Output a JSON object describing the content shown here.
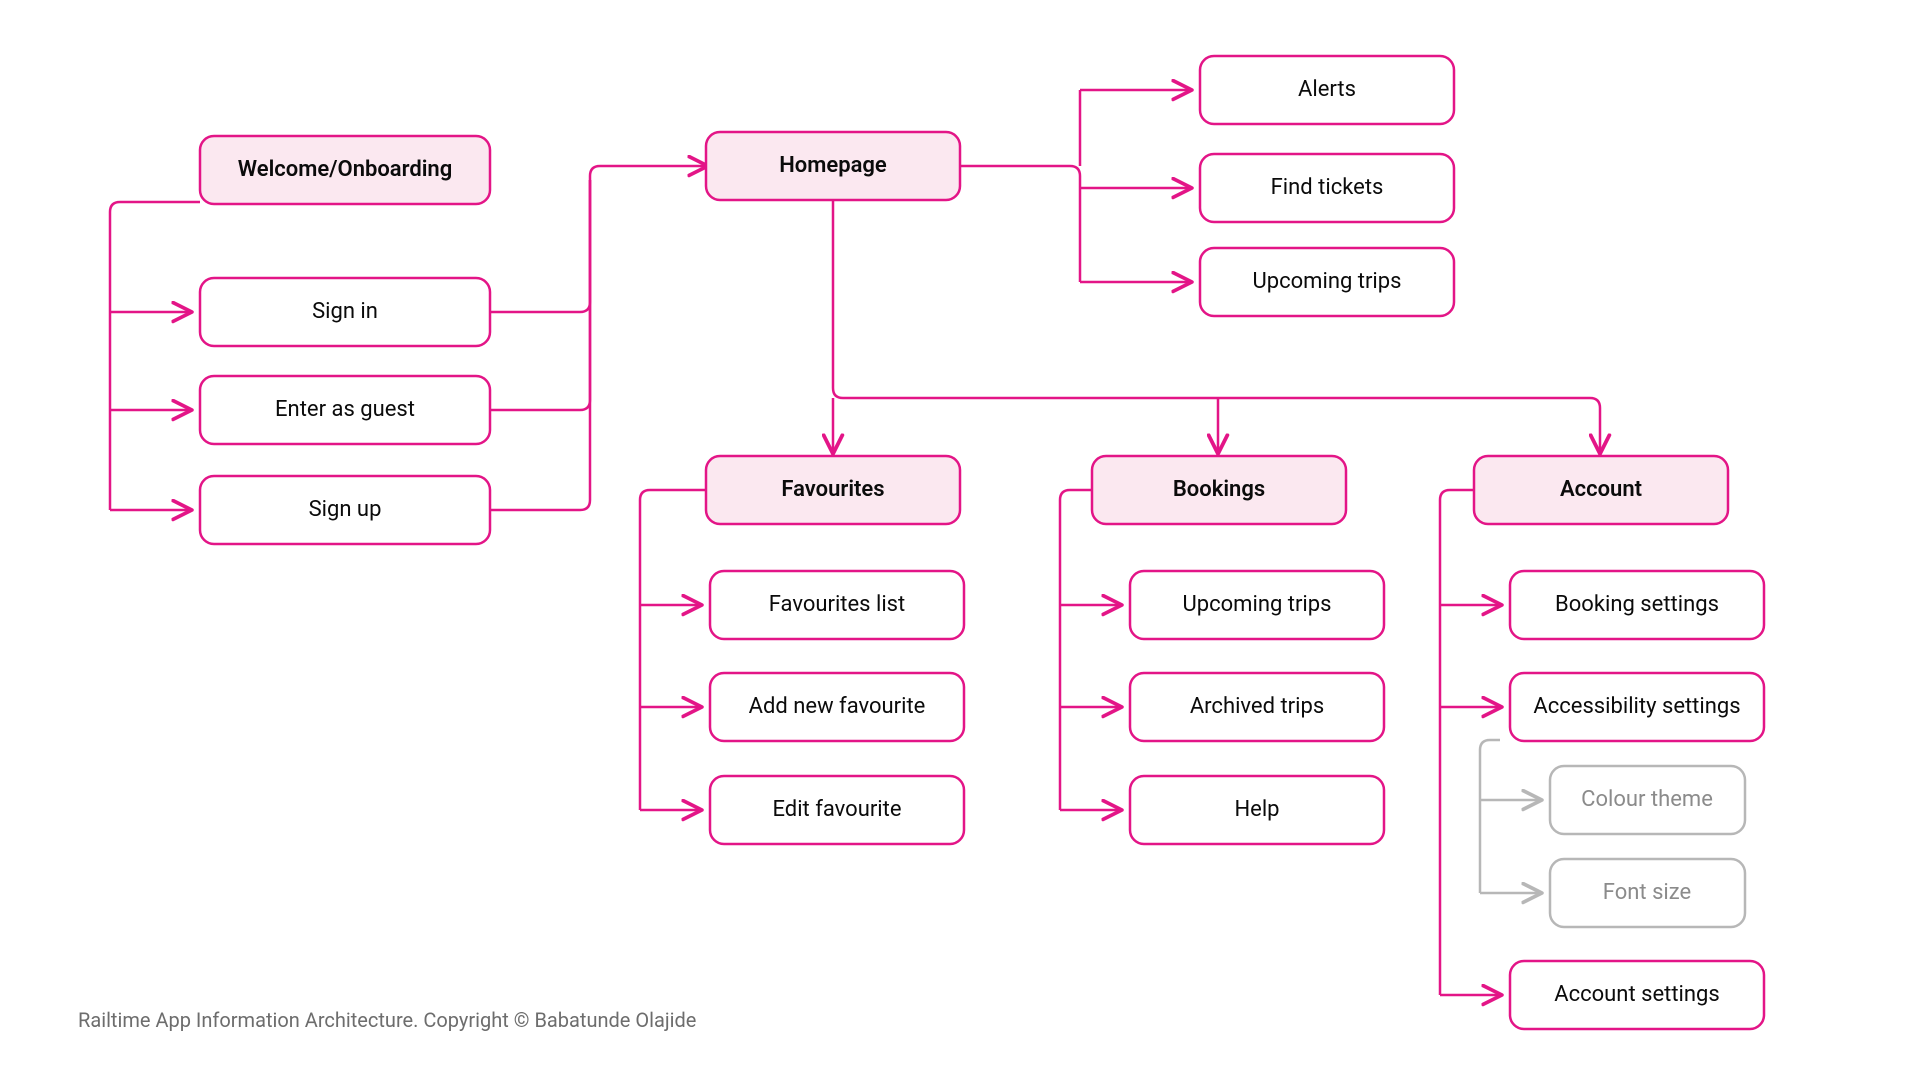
{
  "diagram": {
    "welcome_onboarding": "Welcome/Onboarding",
    "sign_in": "Sign in",
    "enter_as_guest": "Enter as guest",
    "sign_up": "Sign up",
    "homepage": "Homepage",
    "homepage_children": {
      "alerts": "Alerts",
      "find_tickets": "Find tickets",
      "upcoming_trips": "Upcoming trips"
    },
    "favourites": "Favourites",
    "favourites_children": {
      "favourites_list": "Favourites list",
      "add_new_favourite": "Add new favourite",
      "edit_favourite": "Edit favourite"
    },
    "bookings": "Bookings",
    "bookings_children": {
      "upcoming_trips": "Upcoming trips",
      "archived_trips": "Archived trips",
      "help": "Help"
    },
    "account": "Account",
    "account_children": {
      "booking_settings": "Booking settings",
      "accessibility_settings": "Accessibility settings",
      "accessibility_sub": {
        "colour_theme": "Colour theme",
        "font_size": "Font size"
      },
      "account_settings": "Account settings"
    }
  },
  "footer": "Railtime App Information Architecture. Copyright ©  Babatunde Olajide"
}
